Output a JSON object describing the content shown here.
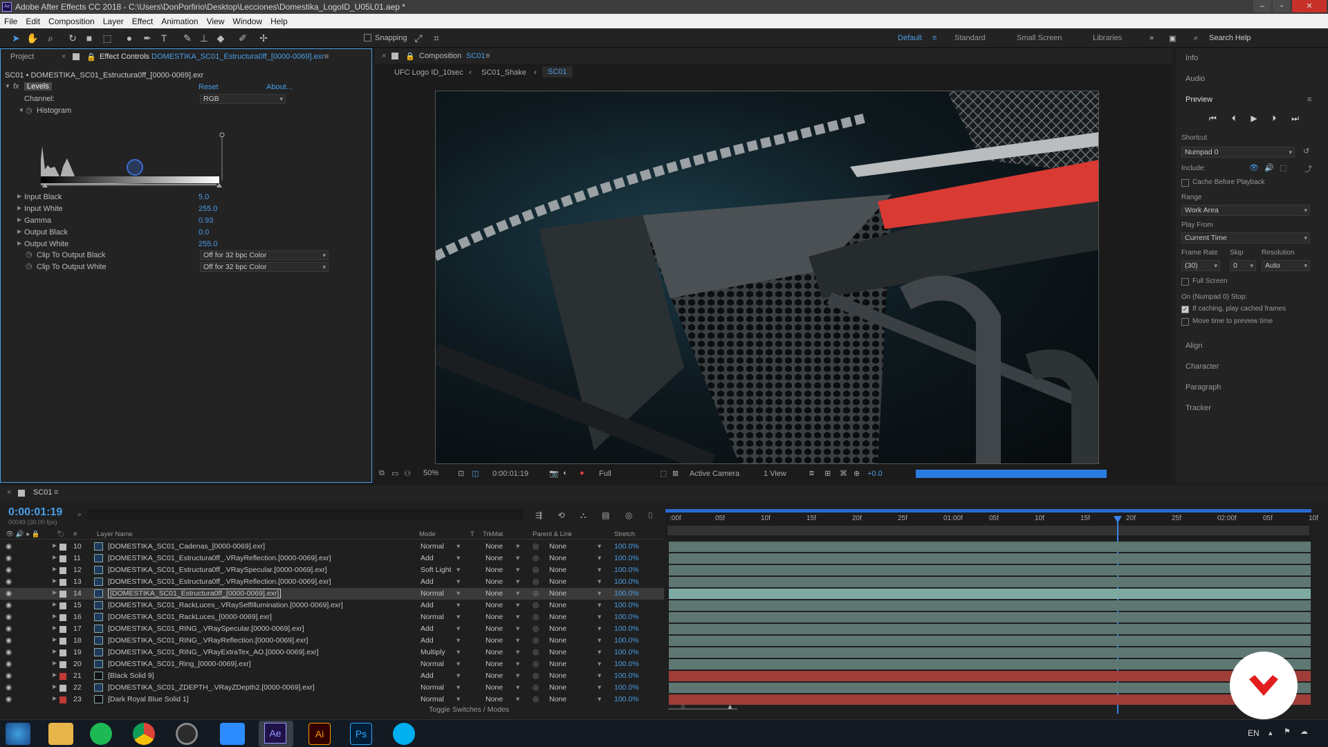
{
  "window": {
    "title": "Adobe After Effects CC 2018 - C:\\Users\\DonPorfirio\\Desktop\\Lecciones\\Domestika_LogoID_U05L01.aep *"
  },
  "menu": [
    "File",
    "Edit",
    "Composition",
    "Layer",
    "Effect",
    "Animation",
    "View",
    "Window",
    "Help"
  ],
  "toolbar": {
    "snapping": "Snapping",
    "workspaces": [
      "Default",
      "Standard",
      "Small Screen",
      "Libraries"
    ],
    "search_placeholder": "Search Help"
  },
  "effect_panel": {
    "tab_project": "Project",
    "tab_effect": "Effect Controls",
    "tab_effect_layer": "DOMESTIKA_SC01_Estructura0ff_[0000-0069].exr",
    "breadcrumb": "SC01 • DOMESTIKA_SC01_Estructura0ff_[0000-0069].exr",
    "effect_name": "Levels",
    "reset": "Reset",
    "about": "About...",
    "channel_label": "Channel:",
    "channel_value": "RGB",
    "histogram_label": "Histogram",
    "props": [
      {
        "label": "Input Black",
        "value": "5.0"
      },
      {
        "label": "Input White",
        "value": "255.0"
      },
      {
        "label": "Gamma",
        "value": "0.93"
      },
      {
        "label": "Output Black",
        "value": "0.0"
      },
      {
        "label": "Output White",
        "value": "255.0"
      }
    ],
    "clip_black_label": "Clip To Output Black",
    "clip_black_value": "Off for 32 bpc Color",
    "clip_white_label": "Clip To Output White",
    "clip_white_value": "Off for 32 bpc Color"
  },
  "comp_panel": {
    "tab": "Composition",
    "tab_name": "SC01",
    "crumbs": [
      "UFC Logo ID_10sec",
      "SC01_Shake",
      "SC01"
    ],
    "zoom": "50%",
    "time": "0:00:01:19",
    "resolution": "Full",
    "camera": "Active Camera",
    "views": "1 View",
    "exposure": "+0.0"
  },
  "right_panel": {
    "info": "Info",
    "audio": "Audio",
    "preview": "Preview",
    "shortcut_label": "Shortcut",
    "shortcut_value": "Numpad 0",
    "include_label": "Include:",
    "cache_before": "Cache Before Playback",
    "range_label": "Range",
    "range_value": "Work Area",
    "play_from_label": "Play From",
    "play_from_value": "Current Time",
    "frame_rate_label": "Frame Rate",
    "skip_label": "Skip",
    "resolution_label": "Resolution",
    "frame_rate_value": "(30)",
    "skip_value": "0",
    "resolution_value": "Auto",
    "full_screen": "Full Screen",
    "stop_label": "On (Numpad 0) Stop:",
    "if_caching": "If caching, play cached frames",
    "move_time": "Move time to preview time",
    "collapsed": [
      "Align",
      "Character",
      "Paragraph",
      "Tracker"
    ]
  },
  "timeline": {
    "tab": "SC01",
    "timecode": "0:00:01:19",
    "frames": "00049 (30.00 fps)",
    "columns": {
      "layer_name": "Layer Name",
      "mode": "Mode",
      "t": "T",
      "trkmat": "TrkMat",
      "parent": "Parent & Link",
      "stretch": "Stretch"
    },
    "ruler": [
      ":00f",
      "05f",
      "10f",
      "15f",
      "20f",
      "25f",
      "01:00f",
      "05f",
      "10f",
      "15f",
      "20f",
      "25f",
      "02:00f",
      "05f",
      "10f"
    ],
    "toggle": "Toggle Switches / Modes",
    "layers": [
      {
        "num": "10",
        "name": "[DOMESTIKA_SC01_Cadenas_[0000-0069].exr]",
        "mode": "Normal",
        "trk": "None",
        "parent": "None",
        "stretch": "100.0%",
        "color": "#bcbcbc"
      },
      {
        "num": "11",
        "name": "[DOMESTIKA_SC01_Estructura0ff_.VRayReflection.[0000-0069].exr]",
        "mode": "Add",
        "trk": "None",
        "parent": "None",
        "stretch": "100.0%",
        "color": "#bcbcbc"
      },
      {
        "num": "12",
        "name": "[DOMESTIKA_SC01_Estructura0ff_.VRaySpecular.[0000-0069].exr]",
        "mode": "Soft Light",
        "trk": "None",
        "parent": "None",
        "stretch": "100.0%",
        "color": "#bcbcbc"
      },
      {
        "num": "13",
        "name": "[DOMESTIKA_SC01_Estructura0ff_.VRayReflection.[0000-0069].exr]",
        "mode": "Add",
        "trk": "None",
        "parent": "None",
        "stretch": "100.0%",
        "color": "#bcbcbc"
      },
      {
        "num": "14",
        "name": "[DOMESTIKA_SC01_Estructura0ff_[0000-0069].exr]",
        "mode": "Normal",
        "trk": "None",
        "parent": "None",
        "stretch": "100.0%",
        "color": "#bcbcbc",
        "selected": true
      },
      {
        "num": "15",
        "name": "[DOMESTIKA_SC01_RackLuces_.VRaySelfIllumination.[0000-0069].exr]",
        "mode": "Add",
        "trk": "None",
        "parent": "None",
        "stretch": "100.0%",
        "color": "#bcbcbc"
      },
      {
        "num": "16",
        "name": "[DOMESTIKA_SC01_RackLuces_[0000-0069].exr]",
        "mode": "Normal",
        "trk": "None",
        "parent": "None",
        "stretch": "100.0%",
        "color": "#bcbcbc"
      },
      {
        "num": "17",
        "name": "[DOMESTIKA_SC01_RING_.VRaySpecular.[0000-0069].exr]",
        "mode": "Add",
        "trk": "None",
        "parent": "None",
        "stretch": "100.0%",
        "color": "#bcbcbc"
      },
      {
        "num": "18",
        "name": "[DOMESTIKA_SC01_RING_.VRayReflection.[0000-0069].exr]",
        "mode": "Add",
        "trk": "None",
        "parent": "None",
        "stretch": "100.0%",
        "color": "#bcbcbc"
      },
      {
        "num": "19",
        "name": "[DOMESTIKA_SC01_RING_.VRayExtraTex_AO.[0000-0069].exr]",
        "mode": "Multiply",
        "trk": "None",
        "parent": "None",
        "stretch": "100.0%",
        "color": "#bcbcbc"
      },
      {
        "num": "20",
        "name": "[DOMESTIKA_SC01_Ring_[0000-0069].exr]",
        "mode": "Normal",
        "trk": "None",
        "parent": "None",
        "stretch": "100.0%",
        "color": "#bcbcbc"
      },
      {
        "num": "21",
        "name": "[Black Solid 9]",
        "mode": "Add",
        "trk": "None",
        "parent": "None",
        "stretch": "100.0%",
        "color": "#c23b36",
        "solid": true
      },
      {
        "num": "22",
        "name": "[DOMESTIKA_SC01_ZDEPTH_.VRayZDepth2.[0000-0069].exr]",
        "mode": "Normal",
        "trk": "None",
        "parent": "None",
        "stretch": "100.0%",
        "color": "#bcbcbc"
      },
      {
        "num": "23",
        "name": "[Dark Royal Blue Solid 1]",
        "mode": "Normal",
        "trk": "None",
        "parent": "None",
        "stretch": "100.0%",
        "color": "#c23b36",
        "solid": true
      }
    ]
  },
  "taskbar": {
    "lang": "EN",
    "apps": [
      "start",
      "explorer",
      "spotify",
      "chrome",
      "obs",
      "zoom",
      "after-effects",
      "illustrator",
      "photoshop",
      "skype"
    ],
    "ae": "Ae",
    "ai": "Ai",
    "ps": "Ps"
  }
}
